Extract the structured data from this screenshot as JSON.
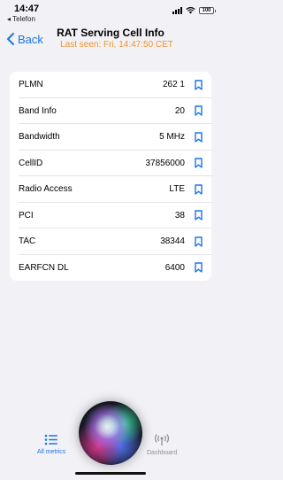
{
  "status_bar": {
    "time": "14:47",
    "back_app": "◂ Telefon",
    "battery": "100"
  },
  "nav": {
    "back_label": "Back",
    "title": "RAT Serving Cell Info",
    "subtitle": "Last seen: Fri, 14:47:50 CET"
  },
  "rows": [
    {
      "label": "PLMN",
      "value": "262 1"
    },
    {
      "label": "Band Info",
      "value": "20"
    },
    {
      "label": "Bandwidth",
      "value": "5 MHz"
    },
    {
      "label": "CellID",
      "value": "37856000"
    },
    {
      "label": "Radio Access",
      "value": "LTE"
    },
    {
      "label": "PCI",
      "value": "38"
    },
    {
      "label": "TAC",
      "value": "38344"
    },
    {
      "label": "EARFCN DL",
      "value": "6400"
    }
  ],
  "tabbar": {
    "all_metrics": "All metrics",
    "dashboard": "Dashboard"
  },
  "colors": {
    "accent": "#1a73e8",
    "subtitle": "#f0922b",
    "background": "#f2f2f6"
  },
  "icons": {
    "row_action": "bookmark-icon",
    "all_metrics": "list-icon",
    "dashboard": "antenna-icon"
  }
}
